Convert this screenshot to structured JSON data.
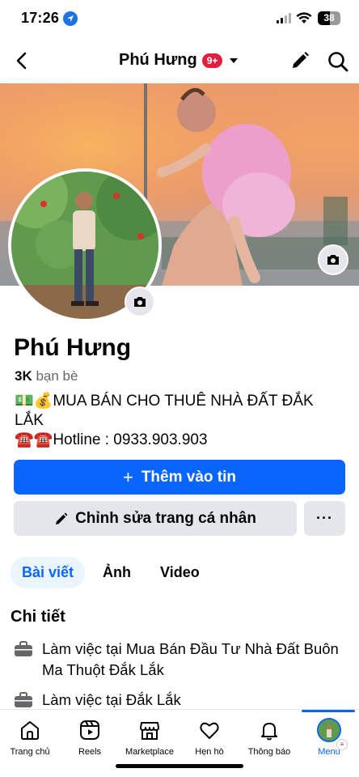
{
  "status_bar": {
    "time": "17:26",
    "battery": "38"
  },
  "header": {
    "title": "Phú Hưng",
    "badge": "9+"
  },
  "profile": {
    "name": "Phú Hưng",
    "friends_count": "3K",
    "friends_label": "bạn bè",
    "bio_line1": "💵💰MUA BÁN CHO THUÊ NHÀ ĐẤT ĐẮK LẮK",
    "bio_line2": "☎️☎️Hotline : 0933.903.903"
  },
  "actions": {
    "primary_label": "Thêm vào tin",
    "primary_prefix": "+",
    "edit_label": "Chỉnh sửa trang cá nhân",
    "more_label": "···"
  },
  "tabs": [
    {
      "label": "Bài viết",
      "active": true
    },
    {
      "label": "Ảnh",
      "active": false
    },
    {
      "label": "Video",
      "active": false
    }
  ],
  "details": {
    "title": "Chi tiết",
    "items": [
      {
        "icon": "briefcase-icon",
        "text": "Làm việc tại Mua Bán Đầu Tư Nhà Đất Buôn Ma Thuột Đắk Lắk"
      },
      {
        "icon": "briefcase-icon",
        "text": "Làm việc tại Đắk Lắk"
      }
    ]
  },
  "bottom_nav": [
    {
      "label": "Trang chủ",
      "icon": "home-icon"
    },
    {
      "label": "Reels",
      "icon": "reels-icon"
    },
    {
      "label": "Marketplace",
      "icon": "marketplace-icon"
    },
    {
      "label": "Hẹn hò",
      "icon": "dating-heart-icon"
    },
    {
      "label": "Thông báo",
      "icon": "bell-icon"
    },
    {
      "label": "Menu",
      "icon": "menu-avatar-icon",
      "active": true
    }
  ],
  "colors": {
    "accent": "#0866ff",
    "badge": "#e41e3f",
    "button_bg": "#e4e6eb"
  }
}
